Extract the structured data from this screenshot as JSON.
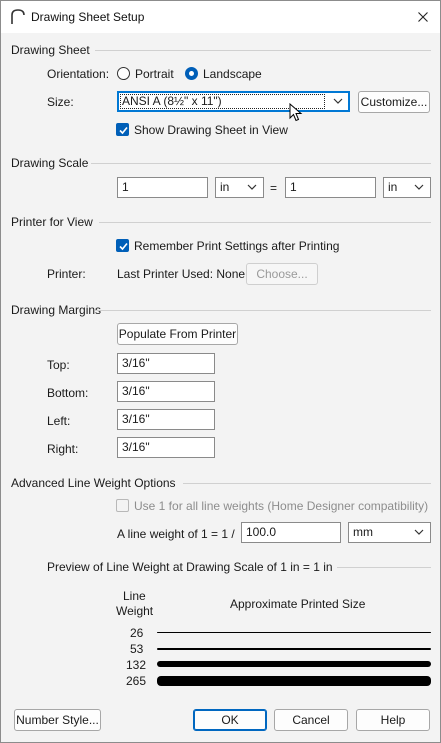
{
  "window": {
    "title": "Drawing Sheet Setup"
  },
  "drawing_sheet": {
    "title": "Drawing Sheet",
    "orientation_label": "Orientation:",
    "portrait_label": "Portrait",
    "landscape_label": "Landscape",
    "orientation_selected": "Landscape",
    "size_label": "Size:",
    "size_value": "ANSI A  (8½\" x 11\")",
    "customize_button": "Customize...",
    "show_sheet_label": "Show Drawing Sheet in View",
    "show_sheet_checked": true
  },
  "drawing_scale": {
    "title": "Drawing Scale",
    "left_value": "1",
    "left_unit": "in",
    "equals": "=",
    "right_value": "1",
    "right_unit": "in"
  },
  "printer_for_view": {
    "title": "Printer for View",
    "remember_label": "Remember Print Settings after Printing",
    "remember_checked": true,
    "printer_label": "Printer:",
    "printer_value": "Last Printer Used: None",
    "choose_button": "Choose..."
  },
  "drawing_margins": {
    "title": "Drawing Margins",
    "populate_button": "Populate From Printer",
    "top_label": "Top:",
    "top_value": "3/16\"",
    "bottom_label": "Bottom:",
    "bottom_value": "3/16\"",
    "left_label": "Left:",
    "left_value": "3/16\"",
    "right_label": "Right:",
    "right_value": "3/16\""
  },
  "line_weight": {
    "title": "Advanced Line Weight Options",
    "use1_label": "Use 1 for all line weights (Home Designer compatibility)",
    "use1_checked": false,
    "weight_label": "A line weight of 1 = 1 /",
    "weight_value": "100.0",
    "weight_unit": "mm",
    "preview_title": "Preview of Line Weight at Drawing Scale of  1 in = 1 in",
    "col_line_weight_1": "Line",
    "col_line_weight_2": "Weight",
    "col_approx_size": "Approximate Printed Size",
    "rows": [
      {
        "weight": "26"
      },
      {
        "weight": "53"
      },
      {
        "weight": "132"
      },
      {
        "weight": "265"
      }
    ]
  },
  "footer": {
    "number_style_button": "Number Style...",
    "ok_button": "OK",
    "cancel_button": "Cancel",
    "help_button": "Help"
  },
  "colors": {
    "accent": "#005fb8",
    "window_bg": "#f3f3f3"
  }
}
